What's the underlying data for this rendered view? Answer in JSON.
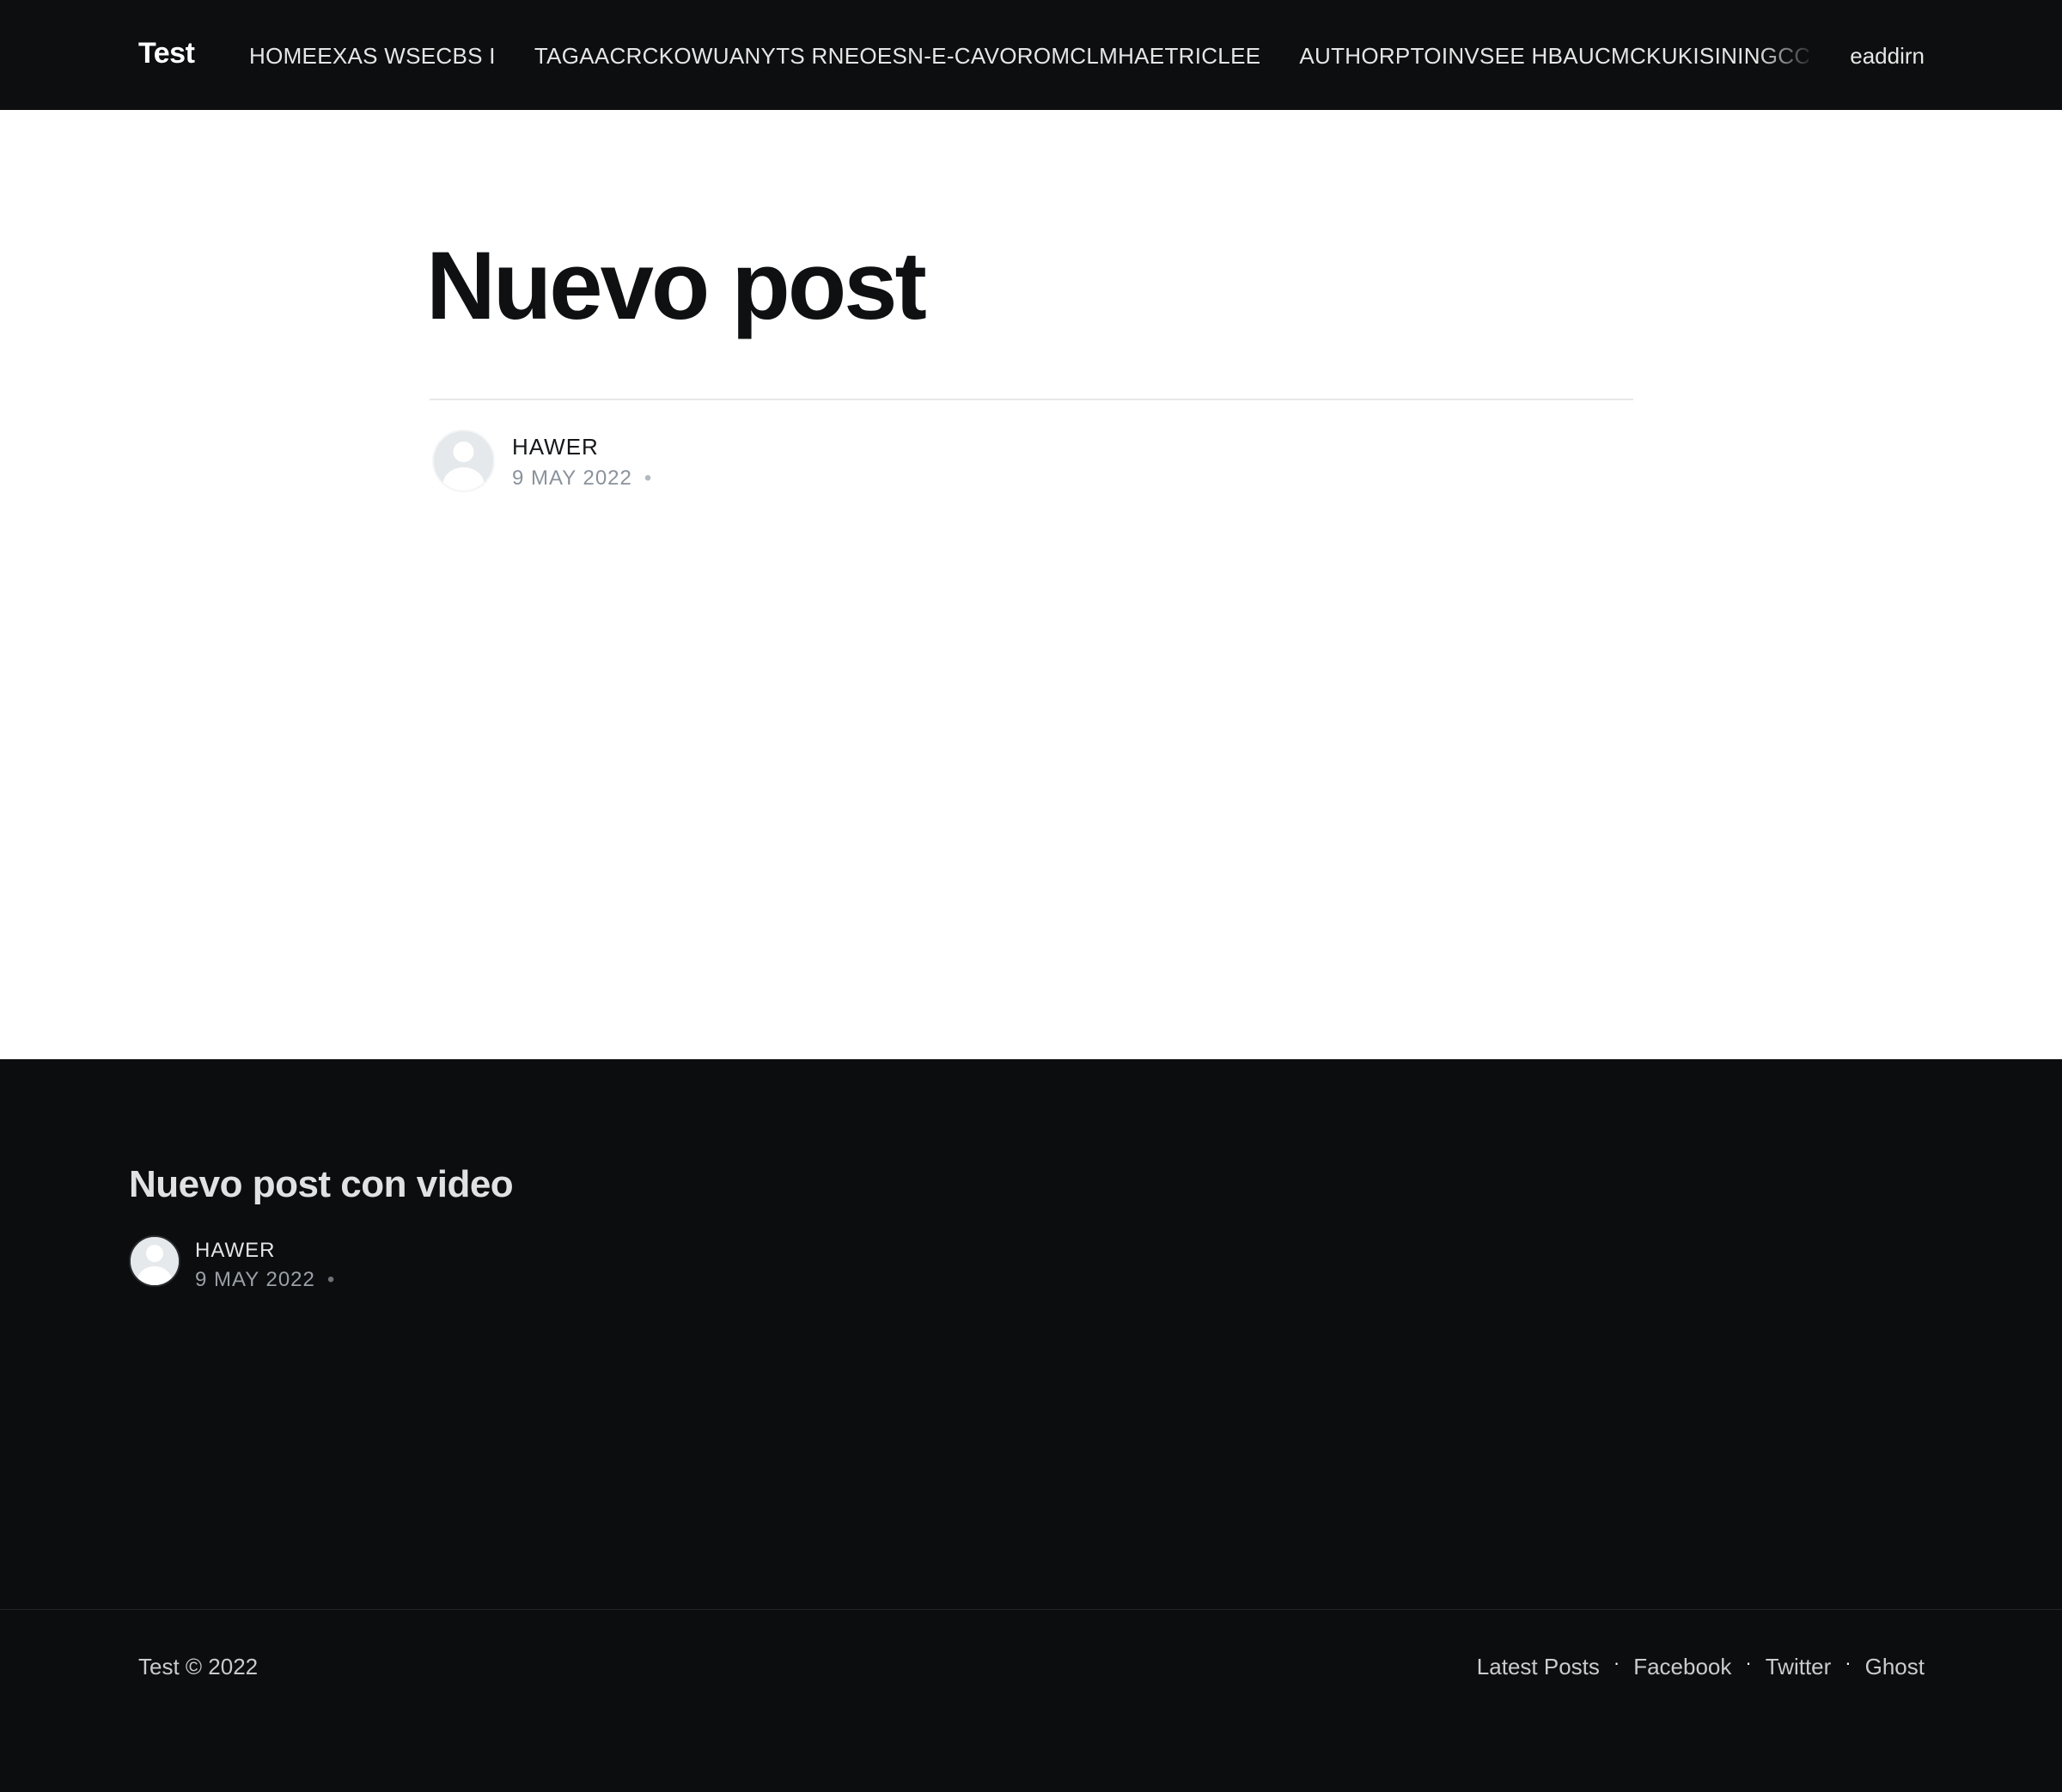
{
  "header": {
    "logo": "Test",
    "nav": [
      "HOMEEXAS WSECBS I",
      "TAGAACRCKOWUANYTS RNEOESN-E-CAVOROMCLMHAETRICLEE",
      "AUTHORPTOINVSEE HBAUCMCKUKISININGCC"
    ],
    "search_label": "eaddirn"
  },
  "article": {
    "title": "Nuevo post",
    "author": "HAWER",
    "date": "9 MAY 2022",
    "separator": "•"
  },
  "related": {
    "title": "Nuevo post con video",
    "author": "HAWER",
    "date": "9 MAY 2022",
    "separator": "•"
  },
  "footer": {
    "copyright": "Test © 2022",
    "links": [
      "Latest Posts",
      "Facebook",
      "Twitter",
      "Ghost"
    ],
    "separator": "·"
  },
  "colors": {
    "header_bg": "#0d0e0f",
    "dark_section_bg": "#0c0d0f",
    "title_text": "#0f1011",
    "meta_gray": "#8a929b"
  },
  "icons": {
    "avatar": "user-avatar-icon"
  }
}
